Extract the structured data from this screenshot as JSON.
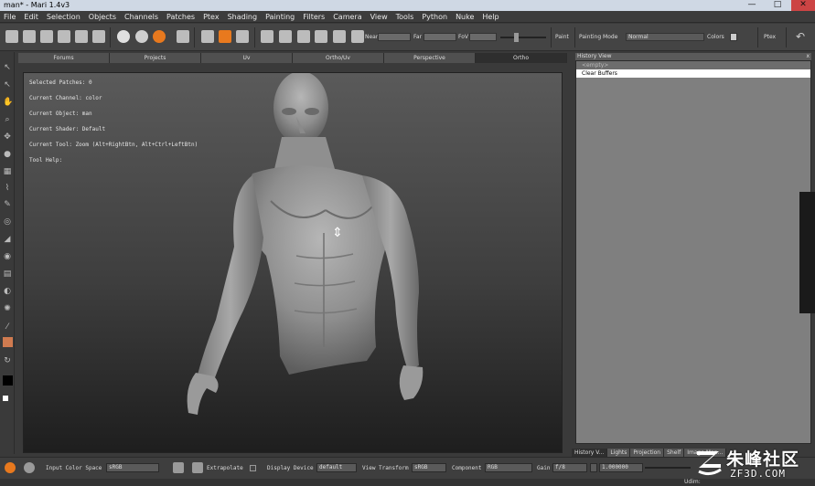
{
  "window": {
    "title": "man* - Mari 1.4v3",
    "minimize": "—",
    "maximize": "□",
    "close": "✕"
  },
  "menu": [
    "File",
    "Edit",
    "Selection",
    "Objects",
    "Channels",
    "Patches",
    "Ptex",
    "Shading",
    "Painting",
    "Filters",
    "Camera",
    "View",
    "Tools",
    "Python",
    "Nuke",
    "Help"
  ],
  "toolbar": {
    "near_label": "Near",
    "far_label": "Far",
    "fov_label": "FoV",
    "paint_label": "Paint",
    "painting_mode_label": "Painting Mode",
    "painting_mode_value": "Normal",
    "colors_label": "Colors",
    "ptex_label": "Ptex"
  },
  "viewport_tabs": [
    "Forums",
    "Projects",
    "Uv",
    "Ortho/Uv",
    "Perspective",
    "Ortho"
  ],
  "active_viewport_tab": "Ortho",
  "viewport_info": [
    "Selected Patches: 0",
    "Current Channel: color",
    "Current Object: man",
    "Current Shader: Default",
    "Current Tool: Zoom (Alt+RightBtn, Alt+Ctrl+LeftBtn)",
    "Tool Help:"
  ],
  "history": {
    "title": "History View",
    "close": "x",
    "items": [
      {
        "label": "<empty>",
        "state": "empty"
      },
      {
        "label": "Clear Buffers",
        "state": "selected"
      }
    ]
  },
  "right_tabs": [
    "History V...",
    "Lights",
    "Projection",
    "Shelf",
    "Image Man..."
  ],
  "bottom": {
    "input_color_space_label": "Input Color Space",
    "input_color_space_value": "sRGB",
    "extrapolate_label": "Extrapolate",
    "display_device_label": "Display Device",
    "display_device_value": "default",
    "view_transform_label": "View Transform",
    "view_transform_value": "sRGB",
    "component_label": "Component",
    "component_value": "RGB",
    "gain_label": "Gain",
    "gain_value": "f/8",
    "gamma_value": "1.000000"
  },
  "status": {
    "udim_label": "Udim:"
  },
  "watermark": {
    "title": "朱峰社区",
    "subtitle": "ZF3D.COM"
  },
  "colors": {
    "accent": "#e8791e",
    "viewport_top": "#5a5a5a",
    "viewport_bottom": "#1e1e1e",
    "history_bg": "#7f7f7f"
  }
}
